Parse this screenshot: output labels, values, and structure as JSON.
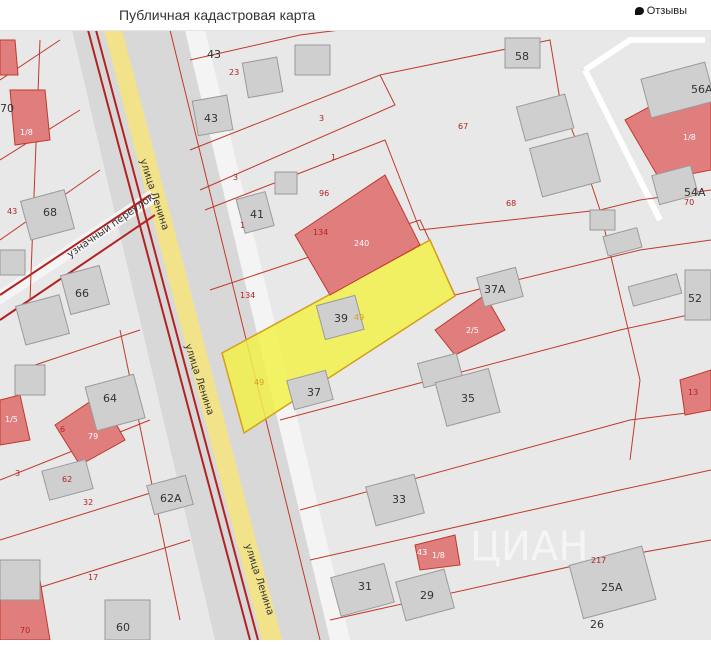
{
  "header": {
    "title": "Публичная кадастровая карта",
    "feedback_label": "Отзывы"
  },
  "map": {
    "streets": [
      "улица Ленина",
      "улица Ленина",
      "улица Ленина",
      "узначный переулок"
    ],
    "house_numbers": [
      "43",
      "43",
      "58",
      "70",
      "56A",
      "41",
      "39",
      "37",
      "37A",
      "35",
      "33",
      "31",
      "29",
      "25A",
      "26",
      "60",
      "62A",
      "64",
      "66",
      "68",
      "52",
      "54A"
    ],
    "parcel_labels": [
      "23",
      "3",
      "3",
      "1",
      "67",
      "68",
      "96",
      "134",
      "134",
      "1",
      "43",
      "70",
      "32",
      "3",
      "17",
      "62",
      "6",
      "13",
      "70",
      "217",
      "49",
      "49",
      "49"
    ],
    "building_labels": [
      "240",
      "2/5",
      "1/8",
      "1/8",
      "1/8",
      "79",
      "70",
      "13",
      "1/5",
      "43"
    ],
    "watermark": "ЦИАН"
  },
  "colors": {
    "background": "#e8e8e8",
    "road": "#d6d6d6",
    "road_yellow": "#f2e28a",
    "parcel_border": "#c0392b",
    "building": "#e07e7e",
    "building_grey": "#cfcfcf",
    "highlight": "#f2f04a"
  }
}
